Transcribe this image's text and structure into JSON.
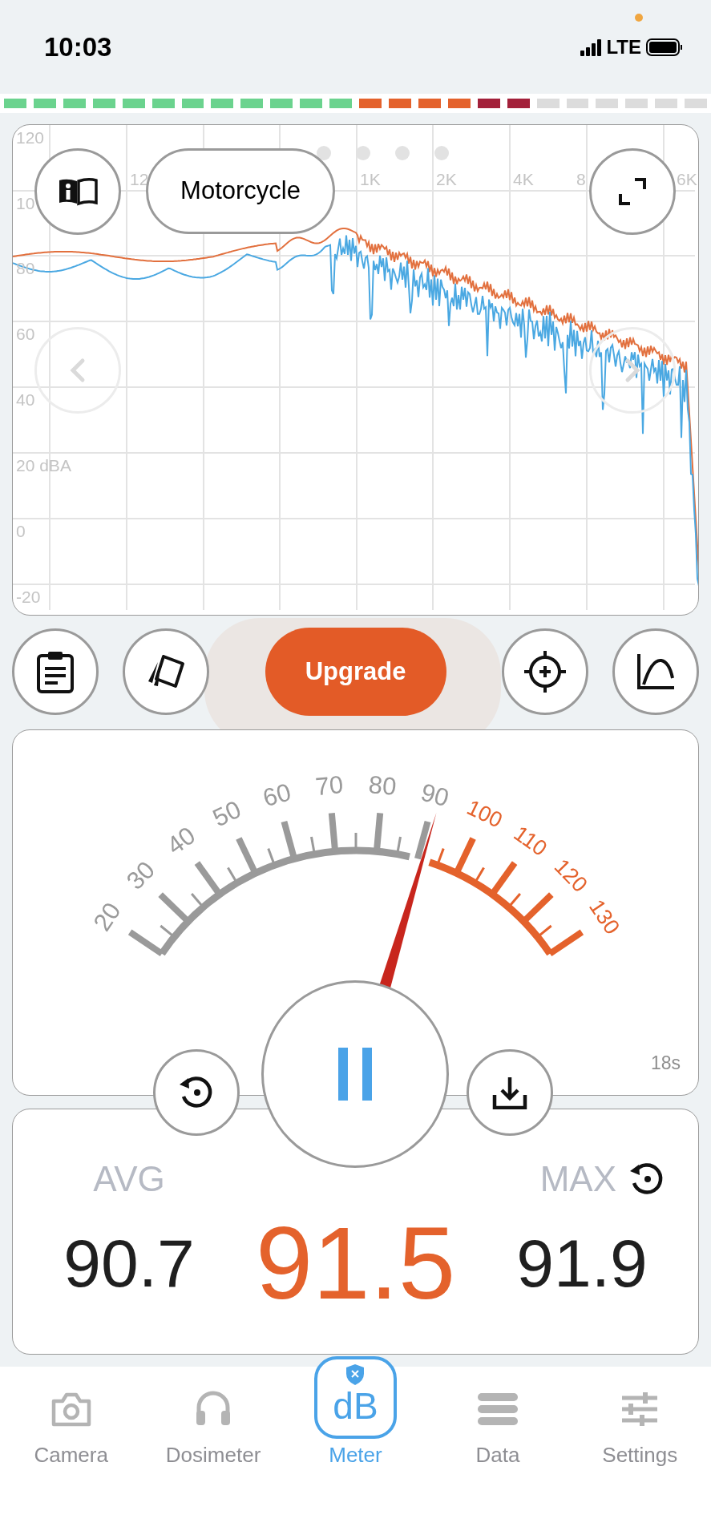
{
  "status_bar": {
    "time": "10:03",
    "network": "LTE"
  },
  "level_meter": {
    "level": 0.75
  },
  "spectrum": {
    "preset": "Motorcycle",
    "y_labels": [
      "120",
      "10",
      "80",
      "60",
      "40",
      "20 dBA",
      "0",
      "-20"
    ],
    "x_labels": [
      "12",
      "1K",
      "2K",
      "4K",
      "8",
      "6K"
    ]
  },
  "tools_left": [
    {
      "kind": "notes"
    },
    {
      "kind": "cards"
    }
  ],
  "upgrade_button": "Upgrade",
  "tools_right": [
    {
      "kind": "target"
    },
    {
      "kind": "curve"
    }
  ],
  "meter": {
    "elapsed": "18s",
    "playing": true,
    "scale": [
      {
        "text": "20",
        "kind": "normal"
      },
      {
        "text": "30",
        "kind": "normal"
      },
      {
        "text": "40",
        "kind": "normal"
      },
      {
        "text": "50",
        "kind": "normal"
      },
      {
        "text": "60",
        "kind": "normal"
      },
      {
        "text": "70",
        "kind": "normal"
      },
      {
        "text": "80",
        "kind": "normal"
      },
      {
        "text": "90",
        "kind": "normal"
      },
      {
        "text": "100",
        "kind": "loud"
      },
      {
        "text": "110",
        "kind": "loud"
      },
      {
        "text": "120",
        "kind": "loud"
      },
      {
        "text": "130",
        "kind": "loud"
      }
    ]
  },
  "stats": {
    "avg_label": "AVG",
    "avg": "90.7",
    "current": "91.5",
    "max_label": "MAX",
    "max": "91.9"
  },
  "tab_bar": {
    "badge_text": "dB",
    "tabs": [
      {
        "label": "Camera",
        "kind": "camera",
        "selected": false
      },
      {
        "label": "Dosimeter",
        "kind": "headphones",
        "selected": false
      },
      {
        "label": "Meter",
        "kind": "meter",
        "selected": true
      },
      {
        "label": "Data",
        "kind": "data",
        "selected": false
      },
      {
        "label": "Settings",
        "kind": "settings",
        "selected": false
      }
    ]
  }
}
